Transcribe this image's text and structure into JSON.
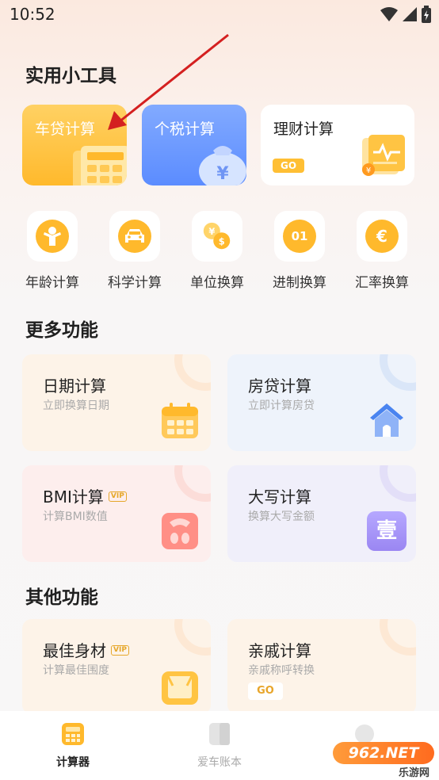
{
  "status": {
    "time": "10:52"
  },
  "section_tools": "实用小工具",
  "top_cards": {
    "car_loan": "车贷计算",
    "tax": "个税计算",
    "finance": "理财计算",
    "finance_badge": "GO"
  },
  "tools": [
    {
      "label": "年龄计算",
      "icon": "person-icon"
    },
    {
      "label": "科学计算",
      "icon": "car-icon"
    },
    {
      "label": "单位换算",
      "icon": "currency-exchange-icon"
    },
    {
      "label": "进制换算",
      "icon": "binary-icon",
      "glyph": "01"
    },
    {
      "label": "汇率换算",
      "icon": "euro-icon",
      "glyph": "€"
    }
  ],
  "section_more": "更多功能",
  "more": [
    {
      "title": "日期计算",
      "sub": "立即换算日期"
    },
    {
      "title": "房贷计算",
      "sub": "立即计算房贷"
    },
    {
      "title": "BMI计算",
      "sub": "计算BMI数值",
      "vip": "VIP"
    },
    {
      "title": "大写计算",
      "sub": "换算大写金额",
      "glyph": "壹"
    }
  ],
  "section_other": "其他功能",
  "other": [
    {
      "title": "最佳身材",
      "sub": "计算最佳围度",
      "vip": "VIP"
    },
    {
      "title": "亲戚计算",
      "sub": "亲戚称呼转换",
      "badge": "GO"
    }
  ],
  "tabs": [
    {
      "label": "计算器",
      "active": true
    },
    {
      "label": "爱车账本",
      "active": false
    }
  ],
  "watermark": {
    "brand": "962.NET",
    "sub": "乐游网"
  },
  "colors": {
    "accent": "#ffb92c",
    "blue": "#5b8cff",
    "vip": "#e6a72a",
    "arrow": "#d42020"
  }
}
